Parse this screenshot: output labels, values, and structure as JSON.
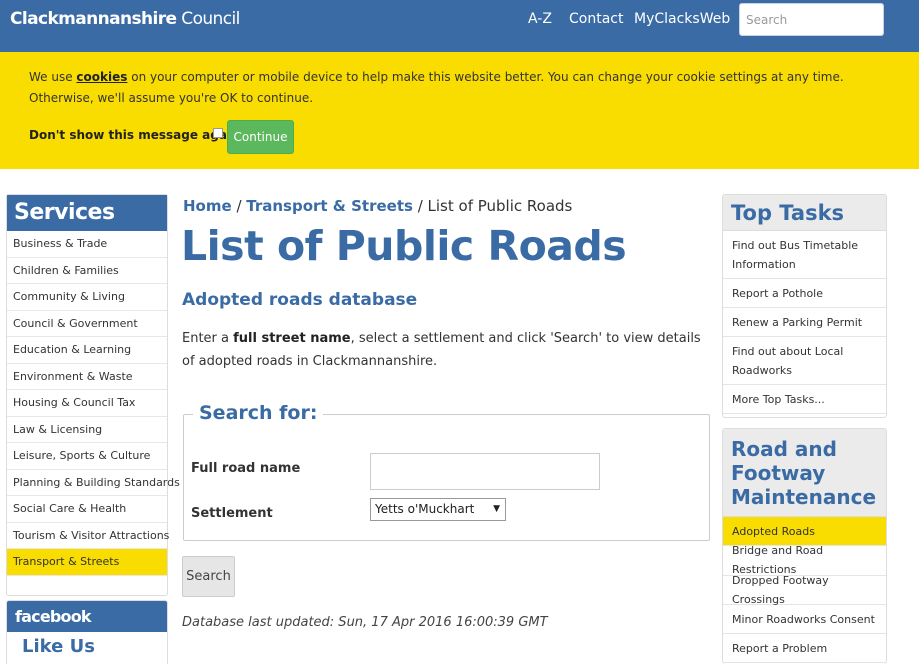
{
  "header": {
    "logo_bold": "Clackmannanshire",
    "logo_rest": " Council",
    "nav": [
      "A-Z",
      "Contact",
      "MyClacksWeb"
    ],
    "search_placeholder": "Search",
    "colors": {
      "brand": "#3a6ba5",
      "accent": "#f9dc00",
      "button_green": "#5cb85c"
    }
  },
  "cookie": {
    "text_before": "We use ",
    "link": "cookies",
    "text_after": " on your computer or mobile device to help make this website better. You can change your cookie settings at any time. Otherwise, we'll assume you're OK to continue.",
    "dont_show": "Don't show this message again",
    "continue": "Continue"
  },
  "sidebar": {
    "title": "Services",
    "items": [
      "Business & Trade",
      "Children & Families",
      "Community & Living",
      "Council & Government",
      "Education & Learning",
      "Environment & Waste",
      "Housing & Council Tax",
      "Law & Licensing",
      "Leisure, Sports & Culture",
      "Planning & Building Standards",
      "Social Care & Health",
      "Tourism & Visitor Attractions",
      "Transport & Streets"
    ],
    "active_index": 12
  },
  "facebook": {
    "title": "facebook",
    "like": "Like Us"
  },
  "breadcrumb": {
    "home": "Home",
    "sep": " / ",
    "section": "Transport & Streets",
    "current": "List of Public Roads"
  },
  "main": {
    "title": "List of Public Roads",
    "subtitle": "Adopted roads database",
    "intro_before": "Enter a ",
    "intro_bold": "full street name",
    "intro_after": ", select a settlement and click 'Search' to view details of adopted roads in Clackmannanshire.",
    "legend": "Search for:",
    "road_label": "Full road name",
    "road_value": "",
    "settlement_label": "Settlement",
    "settlement_value": "Yetts o'Muckhart",
    "search_button": "Search",
    "updated": "Database last updated: Sun, 17 Apr 2016 16:00:39 GMT"
  },
  "top_tasks": {
    "title": "Top Tasks",
    "items": [
      "Find out Bus Timetable Information",
      "Report a Pothole",
      "Renew a Parking Permit",
      "Find out about Local Roadworks",
      "More Top Tasks..."
    ]
  },
  "road_maintenance": {
    "title": "Road and Footway Maintenance",
    "items": [
      "Adopted Roads",
      "Bridge and Road Restrictions",
      "Dropped Footway Crossings",
      "Minor Roadworks Consent",
      "Report a Problem"
    ],
    "active_index": 0
  }
}
